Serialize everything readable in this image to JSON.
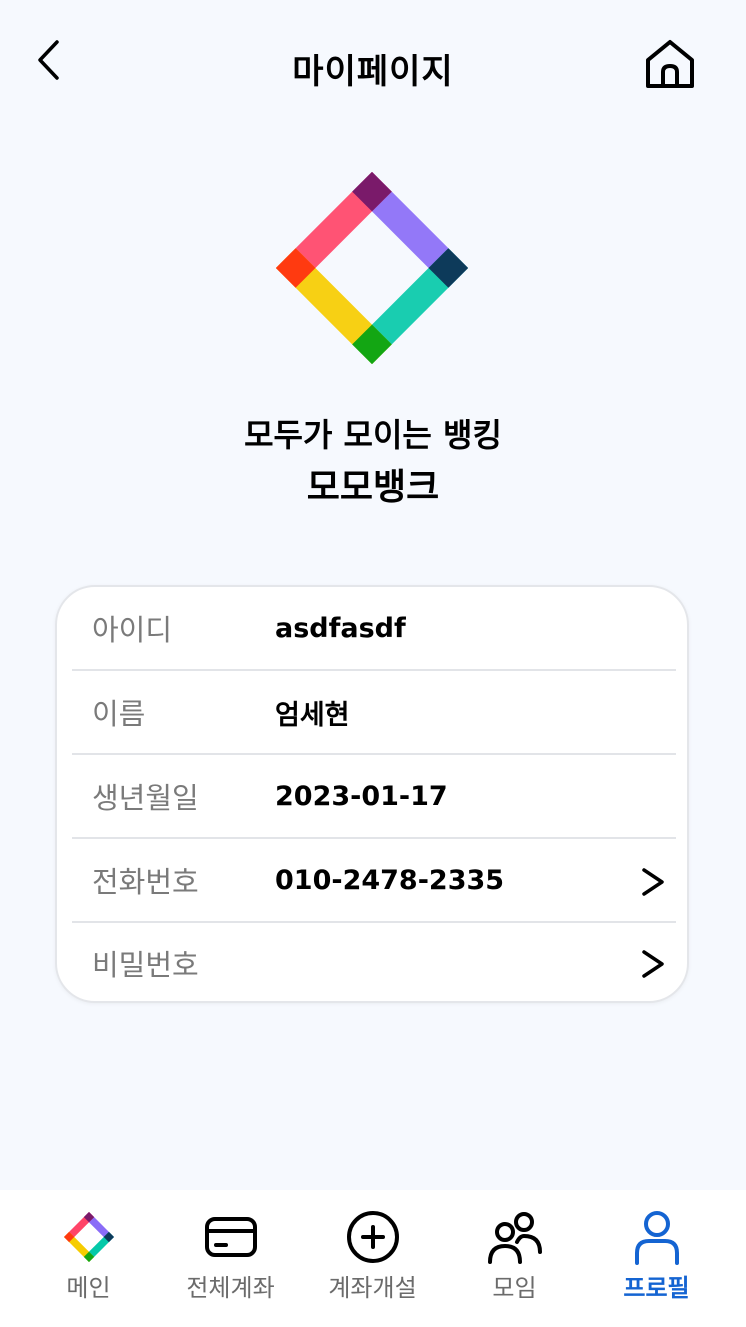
{
  "header": {
    "title": "마이페이지",
    "back_icon": "chevron-left-icon",
    "home_icon": "home-icon"
  },
  "brand": {
    "tagline": "모두가 모이는 뱅킹",
    "name": "모모뱅크",
    "logo_colors": [
      "#8a6cf7",
      "#05c9a9",
      "#ff4468",
      "#f6cc00"
    ]
  },
  "profile": {
    "rows": [
      {
        "label": "아이디",
        "value": "asdfasdf"
      },
      {
        "label": "이름",
        "value": "엄세현"
      },
      {
        "label": "생년월일",
        "value": "2023-01-17"
      },
      {
        "label": "전화번호",
        "value": "010-2478-2335",
        "arrow": ">"
      },
      {
        "label": "비밀번호",
        "value": "",
        "arrow": ">"
      }
    ]
  },
  "tabbar": {
    "active_color": "#1464d2",
    "tabs": [
      {
        "label": "메인",
        "icon": "logo-icon"
      },
      {
        "label": "전체계좌",
        "icon": "card-icon"
      },
      {
        "label": "계좌개설",
        "icon": "plus-circle-icon"
      },
      {
        "label": "모임",
        "icon": "people-icon"
      },
      {
        "label": "프로필",
        "icon": "user-icon",
        "active": true
      }
    ]
  }
}
